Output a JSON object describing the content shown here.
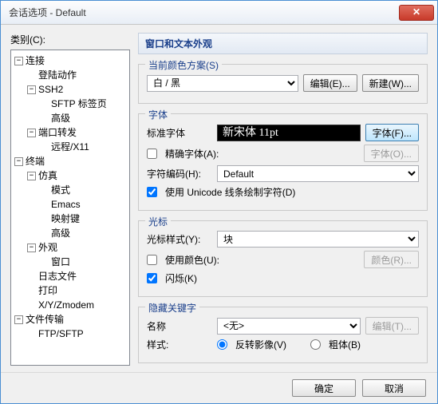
{
  "window": {
    "title": "会话选项 - Default"
  },
  "category_label": "类别(C):",
  "tree": {
    "a": {
      "label": "连接",
      "a1": "登陆动作",
      "a2": {
        "label": "SSH2",
        "a2a": "SFTP 标签页",
        "a2b": "高级"
      },
      "a3": {
        "label": "端口转发",
        "a3a": "远程/X11"
      }
    },
    "b": {
      "label": "终端",
      "b1": {
        "label": "仿真",
        "b1a": "模式",
        "b1b": "Emacs",
        "b1c": "映射键",
        "b1d": "高级"
      },
      "b2": {
        "label": "外观",
        "b2a": "窗口"
      },
      "b3": "日志文件",
      "b4": "打印",
      "b5": "X/Y/Zmodem"
    },
    "c": {
      "label": "文件传输",
      "c1": "FTP/SFTP"
    }
  },
  "panel_title": "窗口和文本外观",
  "scheme": {
    "legend": "当前颜色方案(S)",
    "value": "白 / 黑",
    "edit": "编辑(E)...",
    "new": "新建(W)..."
  },
  "font": {
    "legend": "字体",
    "std_label": "标准字体",
    "sample": "新宋体 11pt",
    "btn": "字体(F)...",
    "precise_label": "精确字体(A):",
    "precise_btn": "字体(O)...",
    "enc_label": "字符编码(H):",
    "enc_value": "Default",
    "unicode_label": "使用 Unicode 线条绘制字符(D)"
  },
  "cursor": {
    "legend": "光标",
    "style_label": "光标样式(Y):",
    "style_value": "块",
    "usecolor_label": "使用颜色(U):",
    "color_btn": "颜色(R)...",
    "blink_label": "闪烁(K)"
  },
  "hidden": {
    "legend": "隐藏关键字",
    "name_label": "名称",
    "name_value": "<无>",
    "edit_btn": "编辑(T)...",
    "style_label": "样式:",
    "invert_label": "反转影像(V)",
    "bold_label": "粗体(B)"
  },
  "footer": {
    "ok": "确定",
    "cancel": "取消"
  }
}
